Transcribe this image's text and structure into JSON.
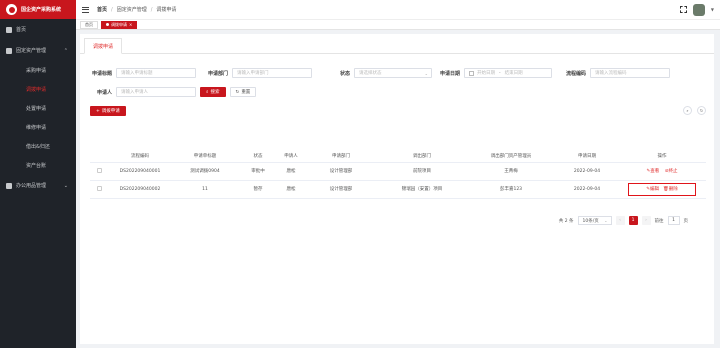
{
  "app": {
    "title": "国企资产采购系统"
  },
  "sidebar": {
    "home": "首页",
    "group1": "固定资产管理",
    "sub": [
      "采购申请",
      "调拨申请",
      "处置申请",
      "维修申请",
      "借出&归还",
      "资产台账"
    ],
    "active_index": 1,
    "group2": "办公用品管理"
  },
  "header": {
    "breadcrumb": [
      "首页",
      "固定资产管理",
      "调拨申请"
    ]
  },
  "tags": {
    "home": "首页",
    "active": "调拨申请"
  },
  "main": {
    "tab": "调拨申请",
    "form": {
      "title_label": "申请标题",
      "title_placeholder": "请输入申请标题",
      "dept_label": "申请部门",
      "dept_placeholder": "请输入申请部门",
      "status_label": "状态",
      "status_placeholder": "请选择状态",
      "date_label": "申请日期",
      "date_start": "开始日期",
      "date_sep": "-",
      "date_end": "结束日期",
      "flow_label": "流程编码",
      "flow_placeholder": "请输入流程编码",
      "applicant_label": "申请人",
      "applicant_placeholder": "请输入申请人",
      "search_btn": "搜索",
      "reset_btn": "重置"
    },
    "add_btn": "调拨申请",
    "table": {
      "headers": [
        "流程编码",
        "申请单标题",
        "状态",
        "申请人",
        "申请部门",
        "调出部门",
        "调出部门资产管理员",
        "申请日期",
        "操作"
      ],
      "rows": [
        {
          "cells": [
            "DS202209040001",
            "测试调拨0904",
            "审批中",
            "唐松",
            "设计管理部",
            "前院项目",
            "王菁梅",
            "2022-09-04"
          ],
          "ops": [
            "查看",
            "终止"
          ]
        },
        {
          "cells": [
            "DS202209040002",
            "11",
            "暂存",
            "唐松",
            "设计管理部",
            "锦瑞园（安置）项目",
            "彭丰嘉123",
            "2022-09-04"
          ],
          "ops": [
            "编辑",
            "删除"
          ]
        }
      ]
    },
    "pagination": {
      "total": "共 2 条",
      "page_size": "10条/页",
      "prev": "‹",
      "current": "1",
      "next": "›",
      "goto_label": "前往",
      "goto_value": "1",
      "page_unit": "页"
    }
  }
}
